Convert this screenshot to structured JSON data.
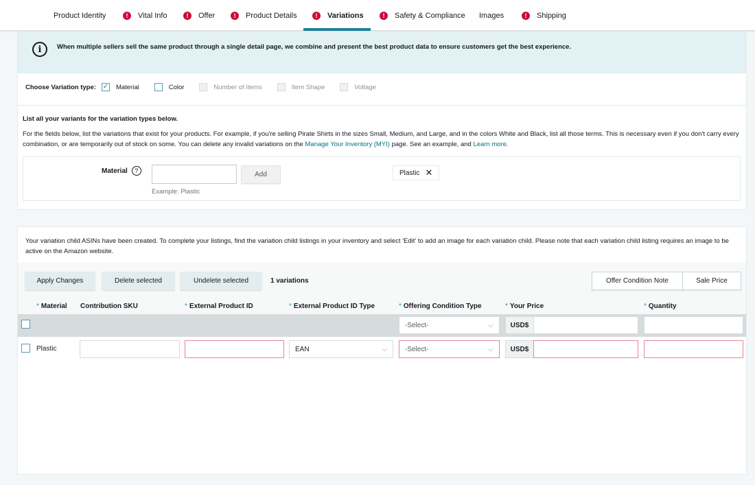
{
  "tabs": [
    {
      "label": "Product Identity",
      "error": false,
      "active": false
    },
    {
      "label": "Vital Info",
      "error": true,
      "active": false
    },
    {
      "label": "Offer",
      "error": true,
      "active": false
    },
    {
      "label": "Product Details",
      "error": true,
      "active": false
    },
    {
      "label": "Variations",
      "error": true,
      "active": true
    },
    {
      "label": "Safety & Compliance",
      "error": true,
      "active": false
    },
    {
      "label": "Images",
      "error": false,
      "active": false
    },
    {
      "label": "Shipping",
      "error": true,
      "active": false
    }
  ],
  "error_icon_glyph": "!",
  "colors": {
    "accent": "#1b7f95",
    "error": "#cc0c39",
    "info_bg": "#e2f1f4",
    "link": "#007185"
  },
  "info": {
    "icon": "info-icon",
    "icon_glyph": "i",
    "text": "When multiple sellers sell the same product through a single detail page, we combine and present the best product data to ensure customers get the best experience."
  },
  "variation_type": {
    "label": "Choose Variation type:",
    "options": [
      {
        "label": "Material",
        "checked": true,
        "disabled": false
      },
      {
        "label": "Color",
        "checked": false,
        "disabled": false
      },
      {
        "label": "Number of Items",
        "checked": false,
        "disabled": true
      },
      {
        "label": "Item Shape",
        "checked": false,
        "disabled": true
      },
      {
        "label": "Voltage",
        "checked": false,
        "disabled": true
      }
    ],
    "check_glyph": "✓"
  },
  "variants": {
    "title": "List all your variants for the variation types below.",
    "desc_1": "For the fields below, list the variations that exist for your products. For example, if you're selling Pirate Shirts in the sizes Small, Medium, and Large, and in the colors White and Black, list all those terms. This is necessary even if you don't carry every combination, or are temporarily out of stock on some. You can delete any invalid variations on the ",
    "link_1": "Manage Your Inventory (MYI)",
    "desc_2": " page. See an example, and ",
    "link_2": "Learn more",
    "desc_3": ".",
    "material_label": "Material",
    "help_glyph": "?",
    "material_input_value": "",
    "add_label": "Add",
    "example": "Example: Plastic",
    "chips": [
      {
        "label": "Plastic",
        "remove_glyph": "✕"
      }
    ]
  },
  "children": {
    "notice": "Your variation child ASINs have been created. To complete your listings, find the variation child listings in your inventory and select 'Edit' to add an image for each variation child. Please note that each variation child listing requires an image to be active on the Amazon website.",
    "buttons": {
      "apply": "Apply Changes",
      "delete": "Delete selected",
      "undelete": "Undelete selected",
      "offer_note": "Offer Condition Note",
      "sale_price": "Sale Price"
    },
    "count": "1 variations",
    "required_mark": "*",
    "columns": [
      {
        "label": "Material",
        "required": true
      },
      {
        "label": "Contribution SKU",
        "required": false
      },
      {
        "label": "External Product ID",
        "required": true
      },
      {
        "label": "External Product ID Type",
        "required": true
      },
      {
        "label": "Offering Condition Type",
        "required": true
      },
      {
        "label": "Your Price",
        "required": true
      },
      {
        "label": "Quantity",
        "required": true
      }
    ],
    "bulk_row": {
      "condition": "-Select-",
      "currency": "USD$",
      "price": "",
      "quantity": ""
    },
    "rows": [
      {
        "material": "Plastic",
        "sku": "",
        "external_id": "",
        "external_id_type": "EAN",
        "condition": "-Select-",
        "currency": "USD$",
        "price": "",
        "quantity": ""
      }
    ],
    "chevron_glyph": "⌵"
  }
}
